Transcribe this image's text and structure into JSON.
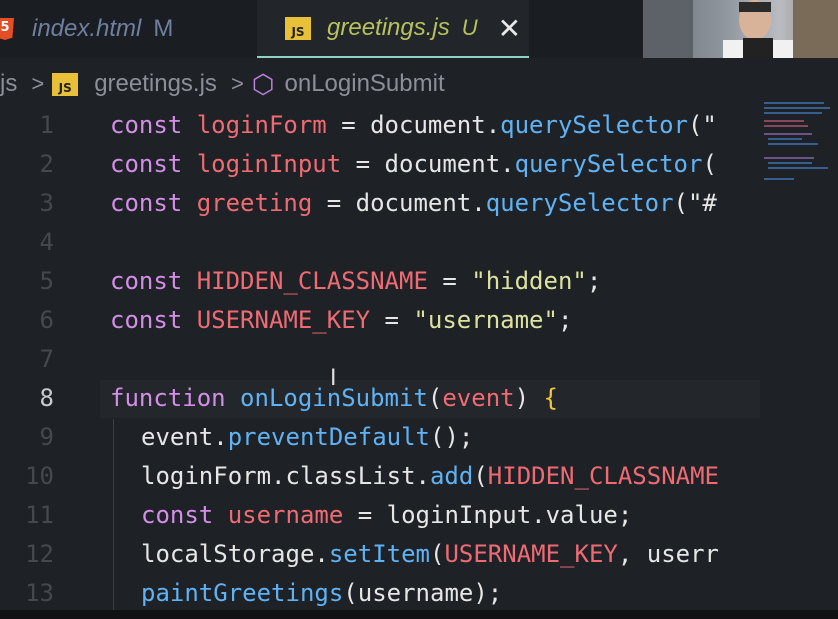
{
  "tabs": [
    {
      "icon": "html5-icon",
      "icon_text": "5",
      "label": "index.html",
      "status": "M"
    },
    {
      "icon": "js-icon",
      "icon_text": "JS",
      "label": "greetings.js",
      "status": "U",
      "close": "✕"
    }
  ],
  "breadcrumb": {
    "root": "js",
    "sep": ">",
    "file_icon_text": "JS",
    "file": "greetings.js",
    "symbol": "onLoginSubmit"
  },
  "editor": {
    "active_line": 8,
    "lines": [
      {
        "n": "1",
        "tokens": [
          [
            "k",
            "const "
          ],
          [
            "v",
            "loginForm"
          ],
          [
            "p",
            " = document."
          ],
          [
            "f",
            "querySelector"
          ],
          [
            "p",
            "(\""
          ]
        ]
      },
      {
        "n": "2",
        "tokens": [
          [
            "k",
            "const "
          ],
          [
            "v",
            "loginInput"
          ],
          [
            "p",
            " = document."
          ],
          [
            "f",
            "querySelector"
          ],
          [
            "p",
            "("
          ]
        ]
      },
      {
        "n": "3",
        "tokens": [
          [
            "k",
            "const "
          ],
          [
            "v",
            "greeting"
          ],
          [
            "p",
            " = document."
          ],
          [
            "f",
            "querySelector"
          ],
          [
            "p",
            "(\"#"
          ]
        ]
      },
      {
        "n": "4",
        "tokens": []
      },
      {
        "n": "5",
        "tokens": [
          [
            "k",
            "const "
          ],
          [
            "v",
            "HIDDEN_CLASSNAME"
          ],
          [
            "p",
            " = "
          ],
          [
            "s",
            "\"hidden\""
          ],
          [
            "p",
            ";"
          ]
        ]
      },
      {
        "n": "6",
        "tokens": [
          [
            "k",
            "const "
          ],
          [
            "v",
            "USERNAME_KEY"
          ],
          [
            "p",
            " = "
          ],
          [
            "s",
            "\"username\""
          ],
          [
            "p",
            ";"
          ]
        ]
      },
      {
        "n": "7",
        "tokens": []
      },
      {
        "n": "8",
        "tokens": [
          [
            "k",
            "function "
          ],
          [
            "f",
            "onLoginSubmit"
          ],
          [
            "p",
            "("
          ],
          [
            "v",
            "event"
          ],
          [
            "p",
            ") "
          ],
          [
            "b",
            "{"
          ]
        ]
      },
      {
        "n": "9",
        "indent": true,
        "tokens": [
          [
            "p",
            "event."
          ],
          [
            "f",
            "preventDefault"
          ],
          [
            "p",
            "();"
          ]
        ]
      },
      {
        "n": "10",
        "indent": true,
        "tokens": [
          [
            "p",
            "loginForm.classList."
          ],
          [
            "f",
            "add"
          ],
          [
            "p",
            "("
          ],
          [
            "v",
            "HIDDEN_CLASSNAME"
          ]
        ]
      },
      {
        "n": "11",
        "indent": true,
        "tokens": [
          [
            "k",
            "const "
          ],
          [
            "v",
            "username"
          ],
          [
            "p",
            " = loginInput."
          ],
          [
            "p",
            "value;"
          ]
        ]
      },
      {
        "n": "12",
        "indent": true,
        "tokens": [
          [
            "p",
            "localStorage."
          ],
          [
            "f",
            "setItem"
          ],
          [
            "p",
            "("
          ],
          [
            "v",
            "USERNAME_KEY"
          ],
          [
            "p",
            ", userr"
          ]
        ]
      },
      {
        "n": "13",
        "indent": true,
        "tokens": [
          [
            "f",
            "paintGreetings"
          ],
          [
            "p",
            "(username);"
          ]
        ]
      }
    ]
  },
  "colors": {
    "background": "#1e2126",
    "keyword": "#d48ee8",
    "variable": "#ef6b73",
    "function": "#5fb3f5",
    "string": "#dde2a0"
  }
}
